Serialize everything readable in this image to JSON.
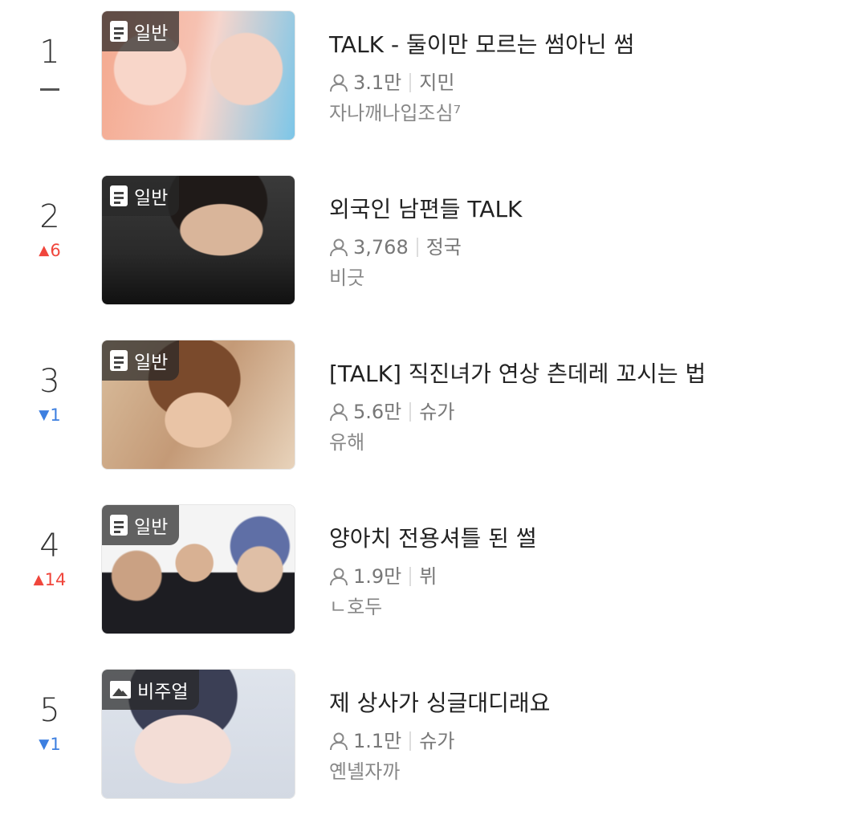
{
  "items": [
    {
      "rank": "1",
      "change": {
        "dir": "same",
        "value": ""
      },
      "badge": "일반",
      "badge_icon": "document-icon",
      "title": "TALK - 둘이만 모르는 썸아닌 썸",
      "views": "3.1만",
      "member": "지민",
      "author": "자나깨나입조심⁷",
      "thumb_colors": [
        "#f4a98f",
        "#f8d6c9",
        "#7cc6e8"
      ]
    },
    {
      "rank": "2",
      "change": {
        "dir": "up",
        "value": "6"
      },
      "badge": "일반",
      "badge_icon": "document-icon",
      "title": "외국인 남편들 TALK",
      "views": "3,768",
      "member": "정국",
      "author": "비긋",
      "thumb_colors": [
        "#2a2a2a",
        "#6b5a4e",
        "#c9a58a"
      ]
    },
    {
      "rank": "3",
      "change": {
        "dir": "down",
        "value": "1"
      },
      "badge": "일반",
      "badge_icon": "document-icon",
      "title": "[TALK] 직진녀가 연상 츤데레 꼬시는 법",
      "views": "5.6만",
      "member": "슈가",
      "author": "유해",
      "thumb_colors": [
        "#c7a383",
        "#8a5a3b",
        "#e6c7a8"
      ]
    },
    {
      "rank": "4",
      "change": {
        "dir": "up",
        "value": "14"
      },
      "badge": "일반",
      "badge_icon": "document-icon",
      "title": "양아치 전용셔틀 된 썰",
      "views": "1.9만",
      "member": "뷔",
      "author": "ㄴ호두",
      "thumb_colors": [
        "#f2f2f2",
        "#1d1d22",
        "#5f6fa6"
      ]
    },
    {
      "rank": "5",
      "change": {
        "dir": "down",
        "value": "1"
      },
      "badge": "비주얼",
      "badge_icon": "image-icon",
      "title": "제 상사가 싱글대디래요",
      "views": "1.1만",
      "member": "슈가",
      "author": "옌녤자까",
      "thumb_colors": [
        "#d9dfe8",
        "#f0d9d4",
        "#3b3f55"
      ]
    }
  ],
  "colors": {
    "up": "#f0463c",
    "down": "#3d7fe0"
  }
}
